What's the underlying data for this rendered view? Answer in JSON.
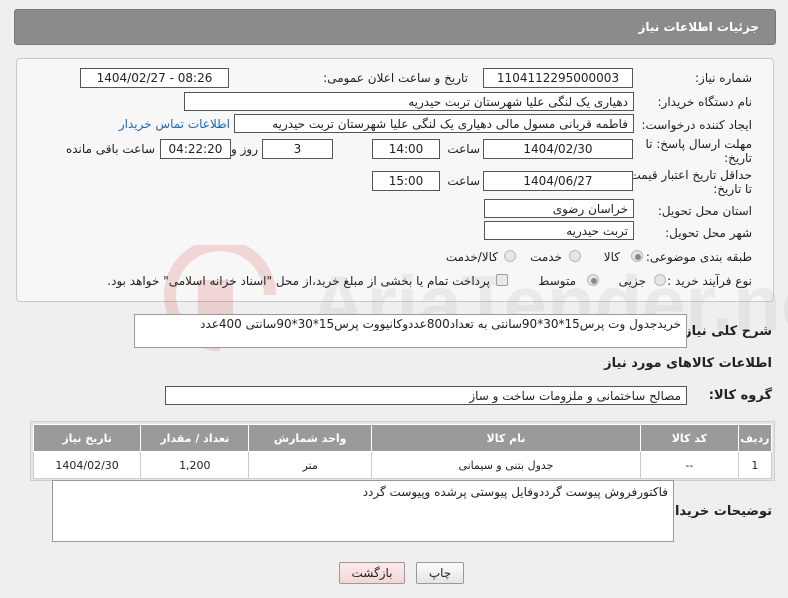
{
  "header": {
    "title": "جزئیات اطلاعات نیاز"
  },
  "form": {
    "need_number_label": "شماره نیاز:",
    "need_number": "1104112295000003",
    "announce_label": "تاریخ و ساعت اعلان عمومی:",
    "announce_value": "1404/02/27 - 08:26",
    "buyer_org_label": "نام دستگاه خریدار:",
    "buyer_org": "دهیاری یک لنگی علیا  شهرستان تربت حیدریه",
    "creator_label": "ایجاد کننده درخواست:",
    "creator": "فاطمه قربانی مسول مالی دهیاری یک لنگی علیا  شهرستان تربت حیدریه",
    "contact_link": "اطلاعات تماس خریدار",
    "deadline_label_1": "مهلت ارسال پاسخ: تا",
    "deadline_label_2": "تاریخ:",
    "deadline_date": "1404/02/30",
    "time_label": "ساعت",
    "deadline_time": "14:00",
    "days_value": "3",
    "days_label": "روز و",
    "remaining_time": "04:22:20",
    "remaining_label": "ساعت باقی مانده",
    "validity_label_1": "حداقل تاریخ اعتبار قیمت:",
    "validity_label_2": "تا تاریخ:",
    "validity_date": "1404/06/27",
    "validity_time_label": "ساعت",
    "validity_time": "15:00",
    "province_label": "استان محل تحویل:",
    "province": "خراسان رضوی",
    "city_label": "شهر محل تحویل:",
    "city": "تربت حیدریه",
    "category_label": "طبقه بندی موضوعی:",
    "category_options": [
      "کالا",
      "خدمت",
      "کالا/خدمت"
    ],
    "process_label": "نوع فرآیند خرید :",
    "process_options": [
      "جزیی",
      "متوسط"
    ],
    "payment_note": "پرداخت تمام یا بخشی از مبلغ خرید،از محل \"اسناد خزانه اسلامی\" خواهد بود."
  },
  "description": {
    "label": "شرح کلی نیاز:",
    "text": "خریدجدول وت پرس15*30*90سانتی به تعداد800عددوکانیووت پرس15*30*90سانتی 400عدد"
  },
  "goods": {
    "section_title": "اطلاعات کالاهای مورد نیاز",
    "group_label": "گروه کالا:",
    "group_value": "مصالح ساختمانی و ملزومات ساخت و ساز",
    "table": {
      "headers": [
        "ردیف",
        "کد کالا",
        "نام کالا",
        "واحد شمارش",
        "تعداد / مقدار",
        "تاریخ نیاز"
      ],
      "rows": [
        [
          "1",
          "--",
          "جدول بتنی و سیمانی",
          "متر",
          "1,200",
          "1404/02/30"
        ]
      ]
    }
  },
  "buyer_notes": {
    "label": "توضیحات خریدار:",
    "text": "فاکتورفروش پیوست گرددوفایل پیوستی پرشده وپیوست گردد"
  },
  "buttons": {
    "print": "چاپ",
    "back": "بازگشت"
  },
  "colors": {
    "header_bg": "#8b8b8b",
    "link": "#1f66b5",
    "back_button": "#f9e1e1"
  }
}
